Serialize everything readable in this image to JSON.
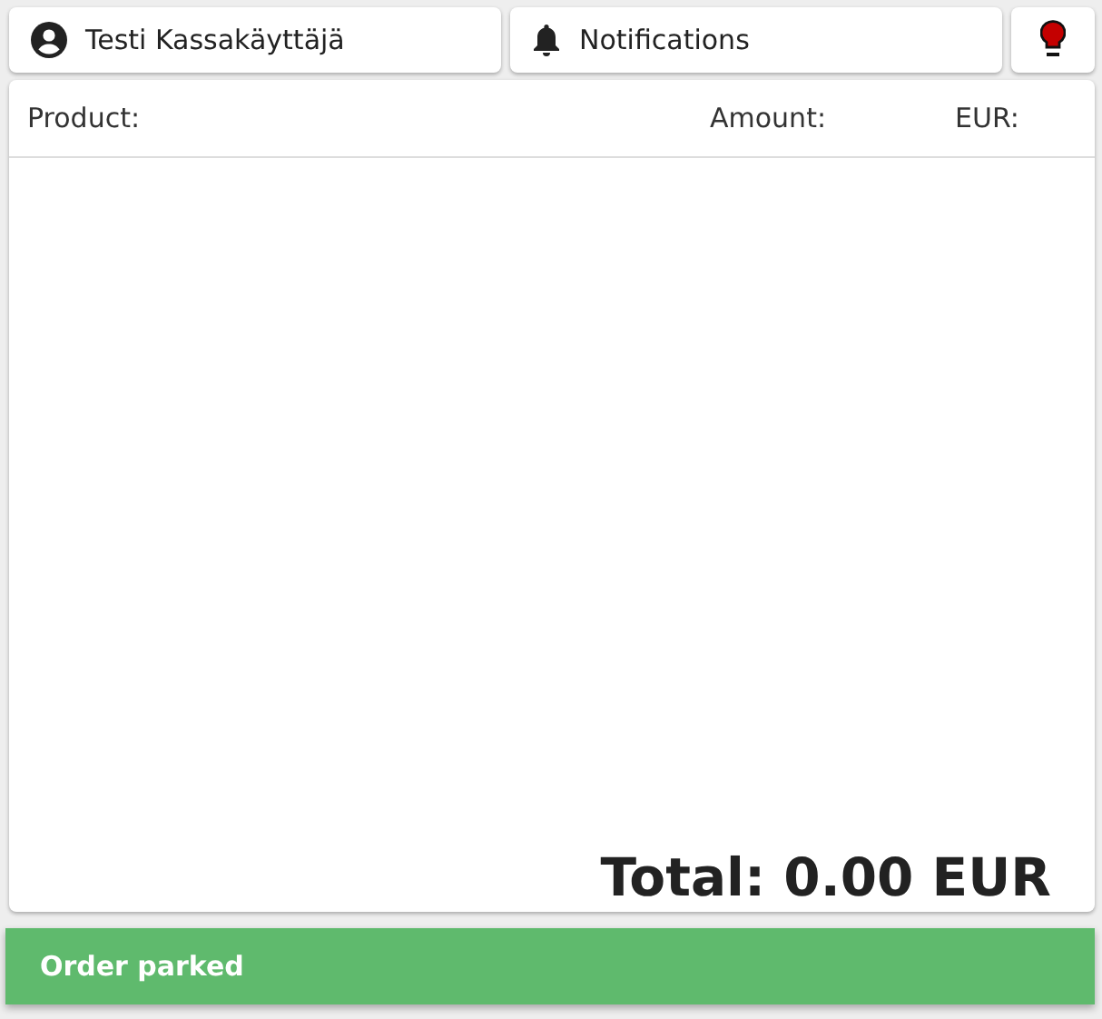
{
  "top_bar": {
    "user": {
      "label": "Testi Kassakäyttäjä"
    },
    "notifications": {
      "label": "Notifications"
    },
    "status_light": {
      "color": "#c40000"
    }
  },
  "order": {
    "columns": [
      "Product:",
      "Amount:",
      "EUR:"
    ],
    "total": "Total: 0.00 EUR"
  },
  "snackbar": {
    "message": "Order parked",
    "kind": "success"
  }
}
